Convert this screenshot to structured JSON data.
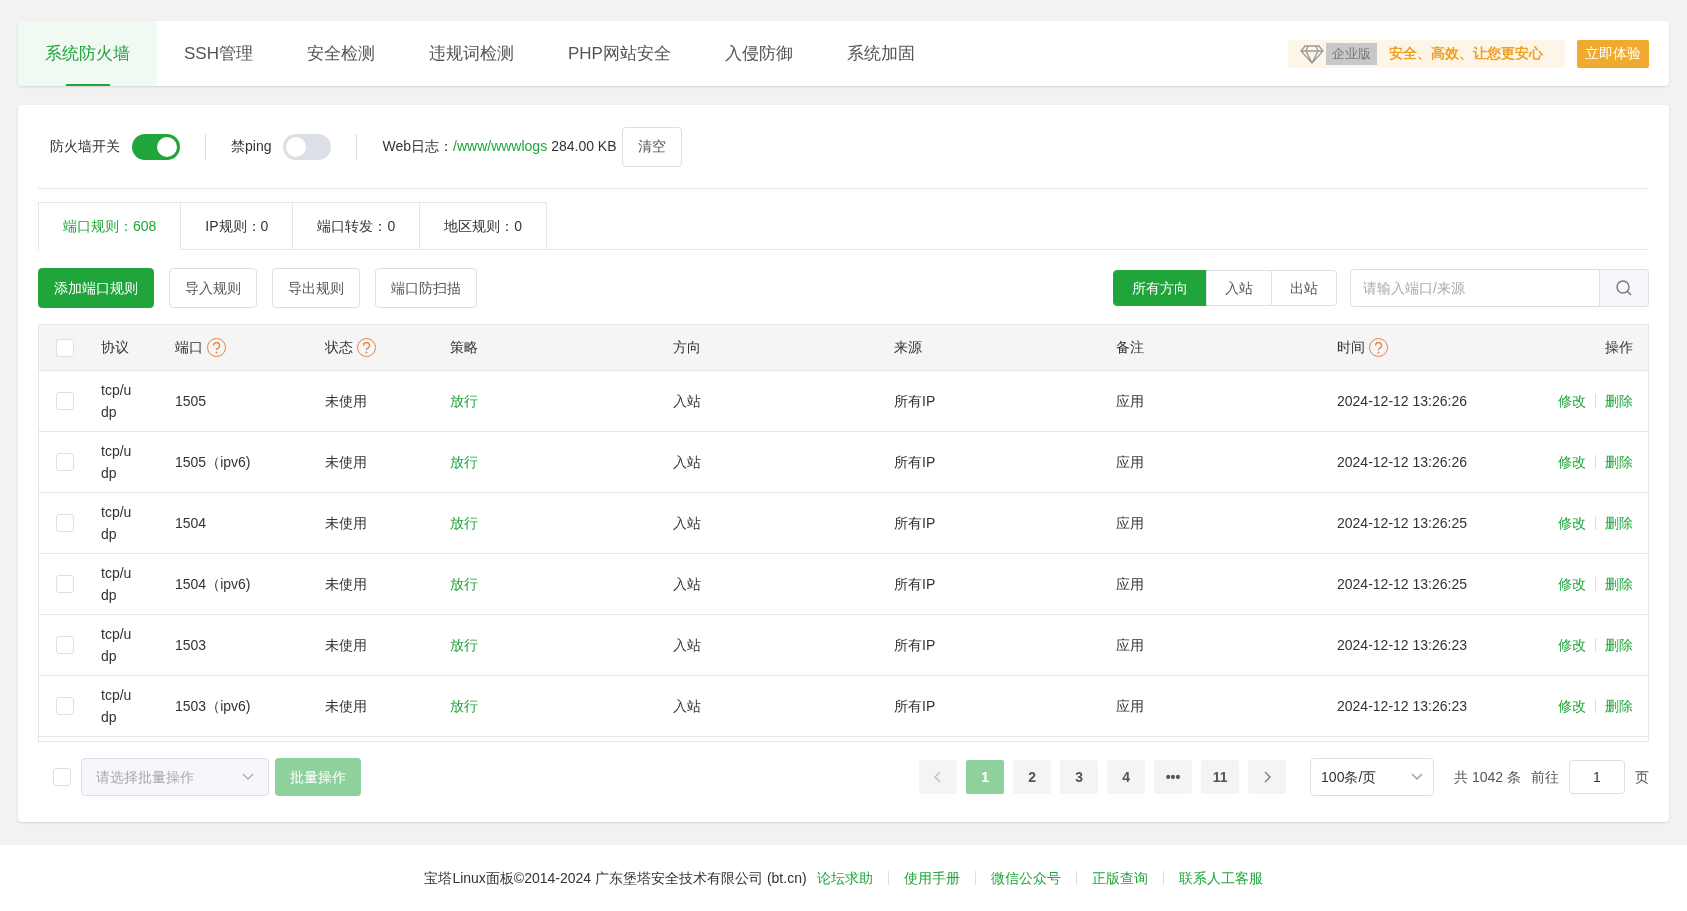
{
  "nav": {
    "tabs": [
      {
        "label": "系统防火墙",
        "selected": true
      },
      {
        "label": "SSH管理",
        "selected": false
      },
      {
        "label": "安全检测",
        "selected": false
      },
      {
        "label": "违规词检测",
        "selected": false
      },
      {
        "label": "PHP网站安全",
        "selected": false
      },
      {
        "label": "入侵防御",
        "selected": false
      },
      {
        "label": "系统加固",
        "selected": false
      }
    ],
    "promo": {
      "badge": "企业版",
      "slogan": "安全、高效、让您更安心",
      "button": "立即体验"
    }
  },
  "settings": {
    "firewall_switch": {
      "label": "防火墙开关",
      "on": true
    },
    "ping_switch": {
      "label": "禁ping",
      "on": false
    },
    "web_log": {
      "label": "Web日志：",
      "path": "/www/wwwlogs",
      "size": "284.00 KB",
      "button": "清空"
    }
  },
  "rule_tabs": [
    {
      "label": "端口规则：608",
      "selected": true
    },
    {
      "label": "IP规则：0",
      "selected": false
    },
    {
      "label": "端口转发：0",
      "selected": false
    },
    {
      "label": "地区规则：0",
      "selected": false
    }
  ],
  "actions": [
    {
      "label": "添加端口规则",
      "kind": "primary"
    },
    {
      "label": "导入规则",
      "kind": "default"
    },
    {
      "label": "导出规则",
      "kind": "default"
    },
    {
      "label": "端口防扫描",
      "kind": "default"
    }
  ],
  "direction_filter": [
    {
      "label": "所有方向",
      "selected": true
    },
    {
      "label": "入站",
      "selected": false
    },
    {
      "label": "出站",
      "selected": false
    }
  ],
  "search": {
    "placeholder": "请输入端口/来源"
  },
  "table": {
    "select_all_checked": false,
    "columns": [
      {
        "label": "协议",
        "help": false
      },
      {
        "label": "端口",
        "help": true
      },
      {
        "label": "状态",
        "help": true
      },
      {
        "label": "策略",
        "help": false
      },
      {
        "label": "方向",
        "help": false
      },
      {
        "label": "来源",
        "help": false
      },
      {
        "label": "备注",
        "help": false
      },
      {
        "label": "时间",
        "help": true
      },
      {
        "label": "操作",
        "help": false
      }
    ],
    "rows": [
      {
        "checked": false,
        "protocol": "tcp/udp",
        "port": "1505",
        "status": "未使用",
        "policy": "放行",
        "direction": "入站",
        "source": "所有IP",
        "remark": "应用",
        "time": "2024-12-12 13:26:26",
        "actions": [
          "修改",
          "删除"
        ]
      },
      {
        "checked": false,
        "protocol": "tcp/udp",
        "port": "1505（ipv6)",
        "status": "未使用",
        "policy": "放行",
        "direction": "入站",
        "source": "所有IP",
        "remark": "应用",
        "time": "2024-12-12 13:26:26",
        "actions": [
          "修改",
          "删除"
        ]
      },
      {
        "checked": false,
        "protocol": "tcp/udp",
        "port": "1504",
        "status": "未使用",
        "policy": "放行",
        "direction": "入站",
        "source": "所有IP",
        "remark": "应用",
        "time": "2024-12-12 13:26:25",
        "actions": [
          "修改",
          "删除"
        ]
      },
      {
        "checked": false,
        "protocol": "tcp/udp",
        "port": "1504（ipv6)",
        "status": "未使用",
        "policy": "放行",
        "direction": "入站",
        "source": "所有IP",
        "remark": "应用",
        "time": "2024-12-12 13:26:25",
        "actions": [
          "修改",
          "删除"
        ]
      },
      {
        "checked": false,
        "protocol": "tcp/udp",
        "port": "1503",
        "status": "未使用",
        "policy": "放行",
        "direction": "入站",
        "source": "所有IP",
        "remark": "应用",
        "time": "2024-12-12 13:26:23",
        "actions": [
          "修改",
          "删除"
        ]
      },
      {
        "checked": false,
        "protocol": "tcp/udp",
        "port": "1503（ipv6)",
        "status": "未使用",
        "policy": "放行",
        "direction": "入站",
        "source": "所有IP",
        "remark": "应用",
        "time": "2024-12-12 13:26:23",
        "actions": [
          "修改",
          "删除"
        ]
      }
    ]
  },
  "batch": {
    "checked": false,
    "placeholder": "请选择批量操作",
    "button": "批量操作",
    "disabled": true
  },
  "pagination": {
    "pages": [
      {
        "label": "1",
        "selected": true
      },
      {
        "label": "2",
        "selected": false
      },
      {
        "label": "3",
        "selected": false
      },
      {
        "label": "4",
        "selected": false
      },
      {
        "label": "•••",
        "selected": false
      },
      {
        "label": "11",
        "selected": false
      }
    ],
    "page_size": "100条/页",
    "total": "共 1042 条",
    "goto_label": "前往",
    "goto_value": "1",
    "page_suffix": "页"
  },
  "footer": {
    "copyright": "宝塔Linux面板©2014-2024 广东堡塔安全技术有限公司 (bt.cn)",
    "links": [
      "论坛求助",
      "使用手册",
      "微信公众号",
      "正版查询",
      "联系人工客服"
    ]
  }
}
